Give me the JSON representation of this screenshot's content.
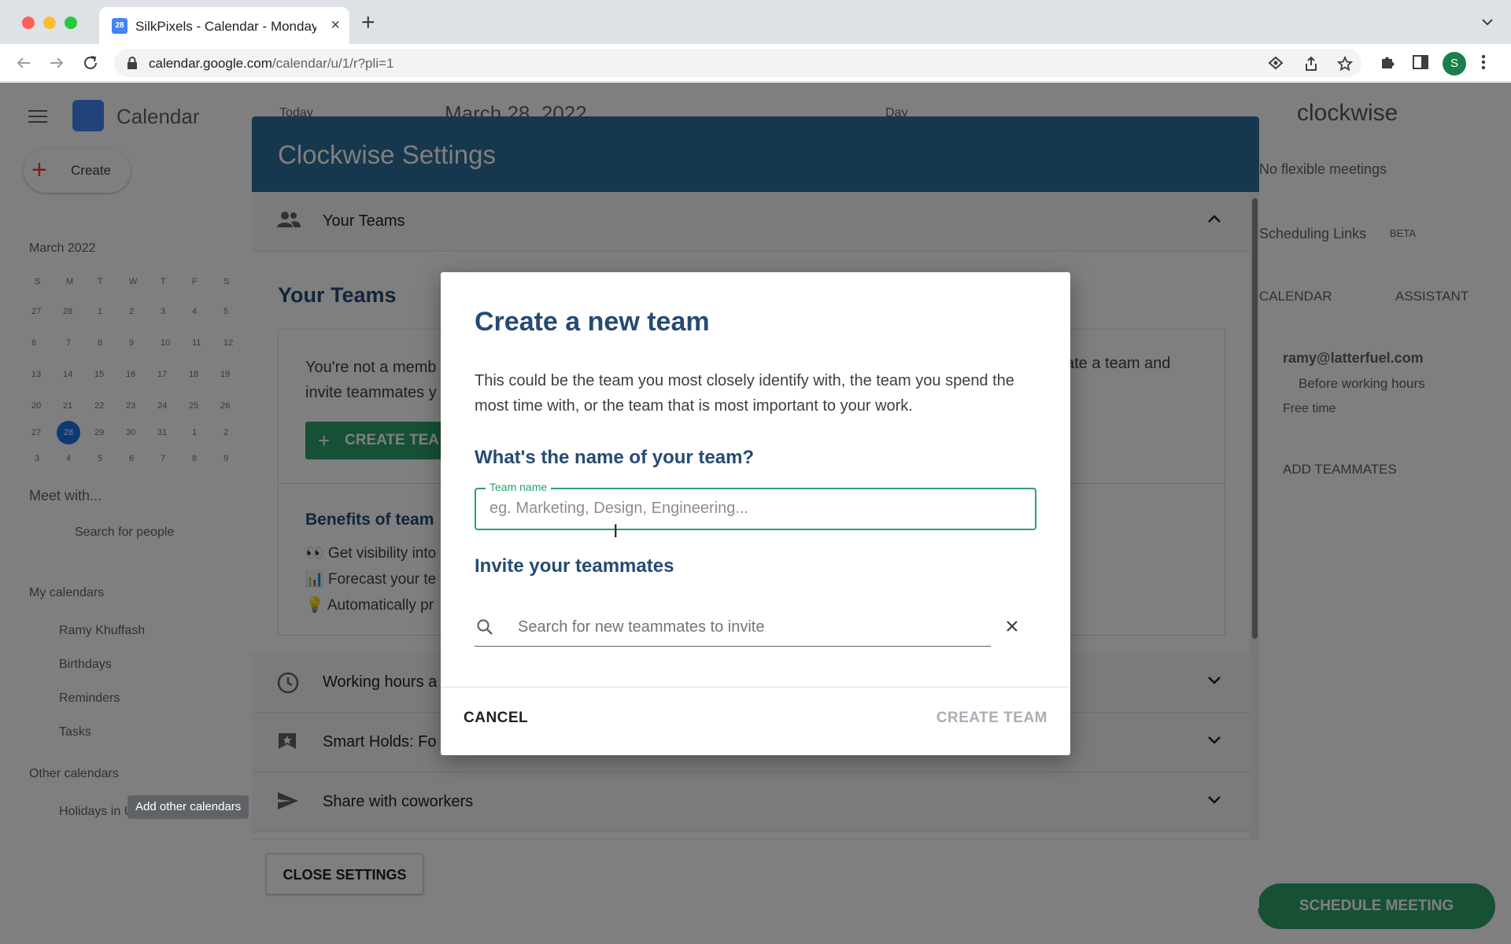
{
  "browser": {
    "tab_title": "SilkPixels - Calendar - Monday",
    "tab_favicon_text": "28",
    "url_host": "calendar.google.com",
    "url_path": "/calendar/u/1/r?pli=1",
    "profile_initial": "S"
  },
  "calendar": {
    "app_name": "Calendar",
    "today_button": "Today",
    "date_header": "March 28, 2022",
    "view_select": "Day",
    "create_button": "Create",
    "mini_month": "March 2022",
    "weekday_headers": [
      "S",
      "M",
      "T",
      "W",
      "T",
      "F",
      "S"
    ],
    "mini_weeks": [
      [
        "27",
        "28",
        "1",
        "2",
        "3",
        "4",
        "5"
      ],
      [
        "6",
        "7",
        "8",
        "9",
        "10",
        "11",
        "12"
      ],
      [
        "13",
        "14",
        "15",
        "16",
        "17",
        "18",
        "19"
      ],
      [
        "20",
        "21",
        "22",
        "23",
        "24",
        "25",
        "26"
      ],
      [
        "27",
        "28",
        "29",
        "30",
        "31",
        "1",
        "2"
      ],
      [
        "3",
        "4",
        "5",
        "6",
        "7",
        "8",
        "9"
      ]
    ],
    "meet_with": "Meet with...",
    "search_people": "Search for people",
    "my_calendars": "My calendars",
    "calendars": [
      "Ramy Khuffash",
      "Birthdays",
      "Reminders",
      "Tasks"
    ],
    "other_calendars": "Other calendars",
    "other_calendar_item": "Holidays in United Kingdom",
    "tooltip_add_other": "Add other calendars"
  },
  "clockwise_sidebar": {
    "brand": "clockwise",
    "no_flexible": "No flexible meetings",
    "scheduling_links": "Scheduling Links",
    "beta_badge": "BETA",
    "tab_calendar": "CALENDAR",
    "tab_assistant": "ASSISTANT",
    "user_email": "ramy@latterfuel.com",
    "user_status": "Before working hours",
    "user_status2": "Free time",
    "add_teammates": "ADD TEAMMATES",
    "schedule_meeting": "SCHEDULE MEETING"
  },
  "settings": {
    "title": "Clockwise Settings",
    "your_teams_row": "Your Teams",
    "section_title": "Your Teams",
    "info_text_left": "You're not a memb",
    "info_text_left2": "invite teammates y",
    "info_text_right": "ate a team and",
    "create_team_button": "CREATE TEA",
    "benefits_title": "Benefits of team",
    "benefits": [
      "👀 Get visibility into",
      "📊 Forecast your te",
      "💡 Automatically pr"
    ],
    "working_hours_row": "Working hours a",
    "smart_holds_row": "Smart Holds: Fo",
    "share_row": "Share with coworkers",
    "close_button": "CLOSE SETTINGS"
  },
  "modal": {
    "title": "Create a new team",
    "description": "This could be the team you most closely identify with, the team you spend the most time with, or the team that is most important to your work.",
    "name_question": "What's the name of your team?",
    "team_name_label": "Team name",
    "team_name_placeholder": "eg. Marketing, Design, Engineering...",
    "team_name_value": "",
    "invite_heading": "Invite your teammates",
    "search_placeholder": "Search for new teammates to invite",
    "search_value": "",
    "cancel_button": "CANCEL",
    "create_button": "CREATE TEAM"
  },
  "colors": {
    "header_blue": "#2f6e9c",
    "heading_navy": "#254b73",
    "accent_green": "#2da06b",
    "disabled_gray": "#a8aeb5"
  }
}
